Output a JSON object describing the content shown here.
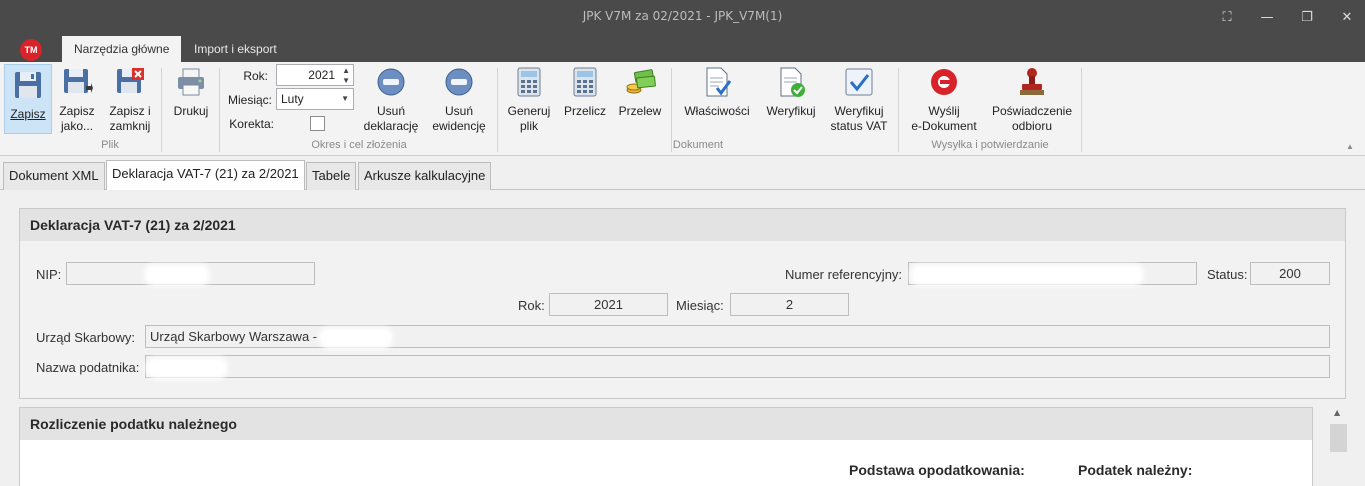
{
  "window": {
    "title": "JPK V7M za 02/2021 - JPK_V7M(1)",
    "controls": {
      "snap": "⛶",
      "minimize": "—",
      "restore": "❐",
      "close": "✕"
    }
  },
  "app": {
    "logo_text": "TM"
  },
  "ribbon_tabs": [
    "Narzędzia główne",
    "Import i eksport"
  ],
  "ribbon": {
    "plik": {
      "label": "Plik",
      "zapisz": "Zapisz",
      "zapisz_jako_1": "Zapisz",
      "zapisz_jako_2": "jako...",
      "zapisz_zamknij_1": "Zapisz i",
      "zapisz_zamknij_2": "zamknij",
      "drukuj": "Drukuj"
    },
    "okres": {
      "label": "Okres i cel złożenia",
      "rok_label": "Rok:",
      "rok_value": "2021",
      "miesiac_label": "Miesiąc:",
      "miesiac_value": "Luty",
      "korekta_label": "Korekta:",
      "usun_dekl_1": "Usuń",
      "usun_dekl_2": "deklarację",
      "usun_ewid_1": "Usuń",
      "usun_ewid_2": "ewidencję"
    },
    "dokument": {
      "label": "Dokument",
      "generuj_1": "Generuj",
      "generuj_2": "plik",
      "przelicz": "Przelicz",
      "przelew": "Przelew",
      "wlasciwosci": "Właściwości",
      "weryfikuj": "Weryfikuj",
      "weryfikuj_vat_1": "Weryfikuj",
      "weryfikuj_vat_2": "status VAT"
    },
    "wysylka": {
      "label": "Wysyłka i potwierdzanie",
      "wyslij_1": "Wyślij",
      "wyslij_2": "e-Dokument",
      "poswiadczenie_1": "Poświadczenie",
      "poswiadczenie_2": "odbioru"
    }
  },
  "doc_tabs": [
    "Dokument XML",
    "Deklaracja VAT-7 (21) za 2/2021",
    "Tabele",
    "Arkusze kalkulacyjne"
  ],
  "declaration": {
    "title": "Deklaracja VAT-7 (21) za 2/2021",
    "nip_label": "NIP:",
    "nip_value": "",
    "ref_label": "Numer referencyjny:",
    "ref_value": "",
    "status_label": "Status:",
    "status_value": "200",
    "rok_label": "Rok:",
    "rok_value": "2021",
    "miesiac_label": "Miesiąc:",
    "miesiac_value": "2",
    "urzad_label": "Urząd Skarbowy:",
    "urzad_value": "Urząd Skarbowy Warszawa -",
    "nazwa_label": "Nazwa podatnika:",
    "nazwa_value": ""
  },
  "settlement": {
    "title": "Rozliczenie podatku należnego",
    "col_podstawa": "Podstawa opodatkowania:",
    "col_podatek": "Podatek należny:"
  },
  "colors": {
    "titlebar": "#4a4a4a",
    "selected": "#cde4f7",
    "brand": "#d8232a"
  }
}
